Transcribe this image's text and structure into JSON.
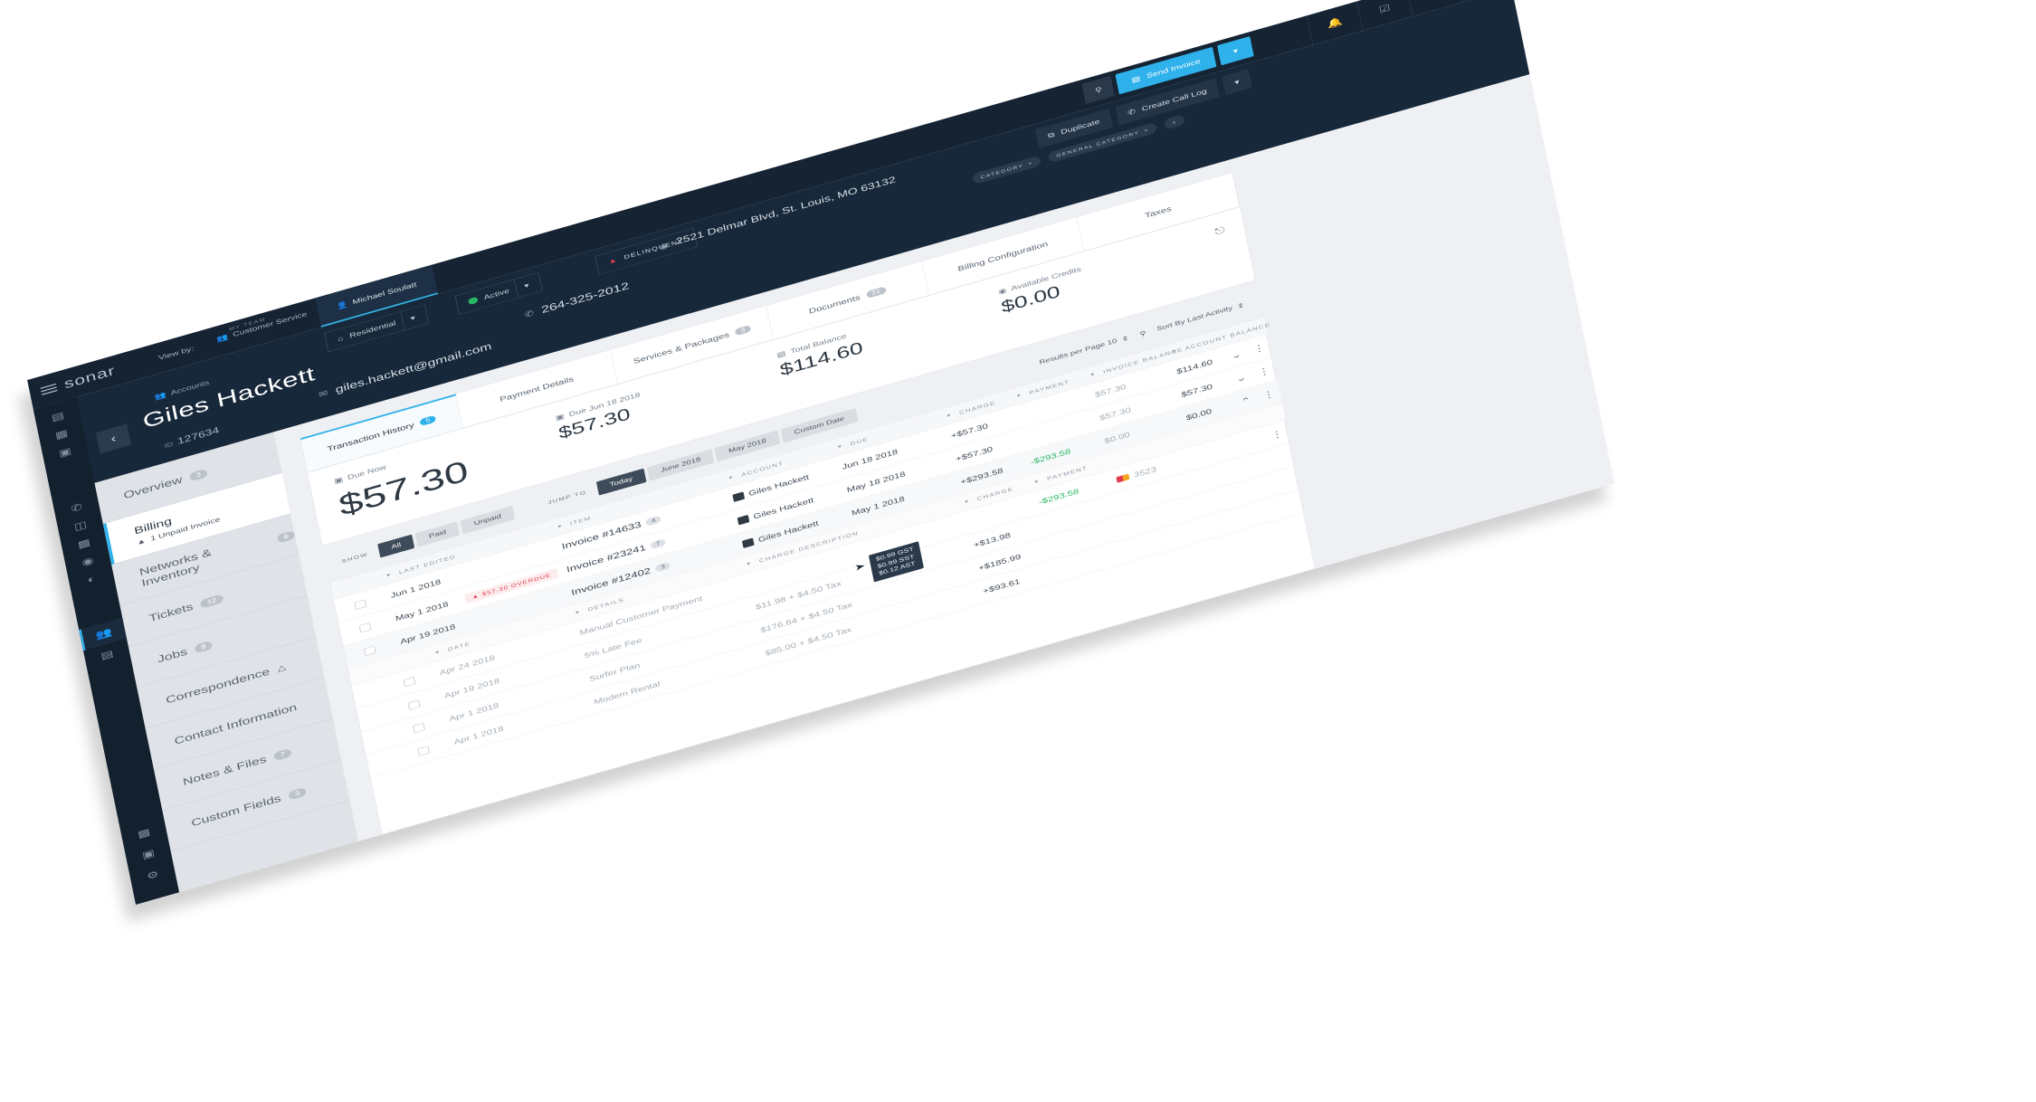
{
  "brand": "sonar",
  "topbar": {
    "view_by": "View by:",
    "team_small": "MY TEAM",
    "team": "Customer Service",
    "user": "Michael Soulatt",
    "send_invoice": "Send Invoice"
  },
  "customer": {
    "accounts_label": "Accounts",
    "name": "Giles Hackett",
    "id_label": "ID",
    "id": "127634",
    "type": "Residential",
    "status": "Active",
    "delinquent": "DELINQUENT",
    "email": "giles.hackett@gmail.com",
    "phone": "264-325-2012",
    "address": "2521 Delmar Blvd, St. Louis, MO 63132",
    "duplicate": "Duplicate",
    "create_call_log": "Create Call Log",
    "category": "CATEGORY",
    "general_category": "GENERAL CATEGORY"
  },
  "subnav": [
    {
      "label": "Overview",
      "count": "3"
    },
    {
      "label": "Billing",
      "sub": "1 Unpaid Invoice",
      "active": true
    },
    {
      "label": "Networks & Inventory",
      "count": "6"
    },
    {
      "label": "Tickets",
      "count": "12"
    },
    {
      "label": "Jobs",
      "count": "8"
    },
    {
      "label": "Correspondence"
    },
    {
      "label": "Contact Information"
    },
    {
      "label": "Notes & Files",
      "count": "7"
    },
    {
      "label": "Custom Fields",
      "count": "3"
    }
  ],
  "tabs": [
    {
      "label": "Transaction History",
      "count": "5"
    },
    {
      "label": "Payment Details"
    },
    {
      "label": "Services & Packages",
      "count": "3"
    },
    {
      "label": "Documents",
      "count": "21"
    },
    {
      "label": "Billing Configuration"
    },
    {
      "label": "Taxes"
    }
  ],
  "balances": {
    "due_now_label": "Due Now",
    "due_now": "$57.30",
    "due_date_label": "Due Jun 18 2018",
    "due_date_value": "$57.30",
    "total_label": "Total Balance",
    "total": "$114.60",
    "credits_label": "Available Credits",
    "credits": "$0.00"
  },
  "toolbar": {
    "show": "SHOW",
    "all": "All",
    "paid": "Paid",
    "unpaid": "Unpaid",
    "jump_to": "JUMP TO",
    "today": "Today",
    "june": "June 2018",
    "may": "May 2018",
    "custom": "Custom Date",
    "per_page": "Results per Page 10",
    "sort": "Sort By Last Activity"
  },
  "table": {
    "headers": {
      "last_edited": "LAST EDITED",
      "item": "ITEM",
      "account": "ACCOUNT",
      "due": "DUE",
      "charge": "CHARGE",
      "payment": "PAYMENT",
      "invoice_balance": "INVOICE BALANCE",
      "account_balance": "ACCOUNT BALANCE"
    },
    "rows": [
      {
        "date": "Jun 1 2018",
        "item": "Invoice #14633",
        "count": "4",
        "account": "Giles Hackett",
        "due": "Jun 18 2018",
        "charge": "+$57.30",
        "inv_bal": "$57.30",
        "acct_bal": "$114.60"
      },
      {
        "date": "May 1 2018",
        "overdue": "$57.30 OVERDUE",
        "item": "Invoice #23241",
        "count": "7",
        "account": "Giles Hackett",
        "due": "May 18 2018",
        "charge": "+$57.30",
        "inv_bal": "$57.30",
        "acct_bal": "$57.30"
      },
      {
        "date": "Apr 19 2018",
        "item": "Invoice #12402",
        "count": "3",
        "account": "Giles Hackett",
        "due": "May 1 2018",
        "charge": "+$293.58",
        "payment": "-$293.58",
        "inv_bal": "$0.00",
        "acct_bal": "$0.00"
      }
    ],
    "detail_headers": {
      "date": "DATE",
      "details": "DETAILS",
      "charge_desc": "CHARGE DESCRIPTION",
      "charge": "CHARGE",
      "payment": "PAYMENT"
    },
    "details": [
      {
        "date": "Apr 24 2018",
        "desc": "Manual Customer Payment",
        "payment": "-$293.58",
        "card": "3523"
      },
      {
        "date": "Apr 19 2018",
        "desc": "5% Late Fee",
        "amount": "$11.98 + $4.50 Tax",
        "charge": "+$13.98"
      },
      {
        "date": "Apr 1 2018",
        "desc": "Surfer Plan",
        "amount": "$176.64 + $4.50 Tax",
        "charge": "+$185.99"
      },
      {
        "date": "Apr 1 2018",
        "desc": "Modem Rental",
        "amount": "$85.00 + $4.50 Tax",
        "charge": "+$93.61"
      }
    ],
    "tooltip": [
      "$0.99 GST",
      "$0.99 SST",
      "$0.12 AST"
    ]
  }
}
